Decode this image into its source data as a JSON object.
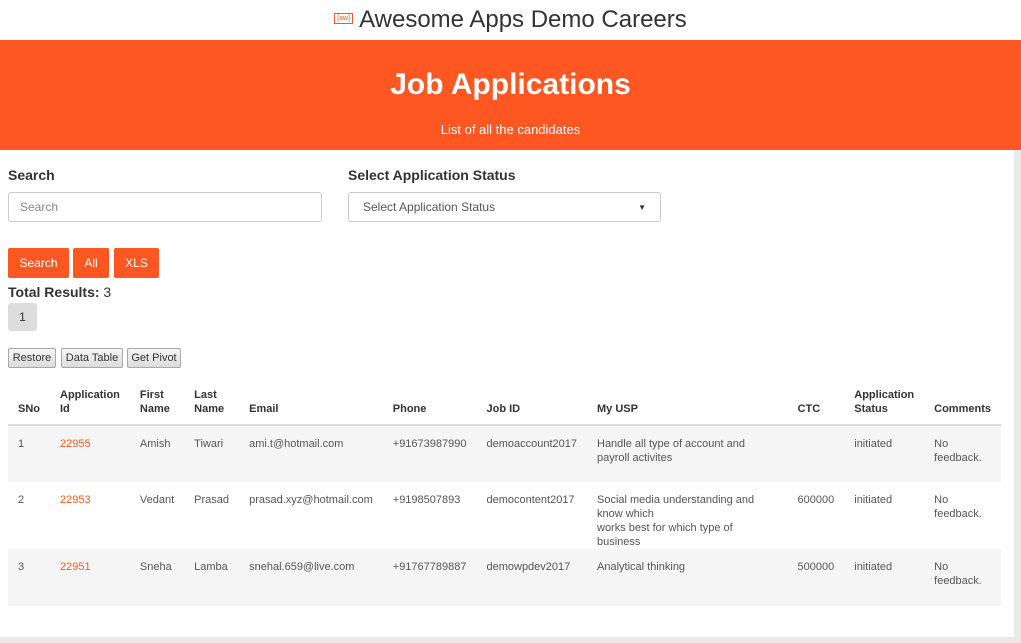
{
  "header": {
    "logo_text": "[aw]",
    "site_title": "Awesome Apps Demo Careers"
  },
  "banner": {
    "title": "Job Applications",
    "subtitle": "List of all the candidates"
  },
  "search": {
    "label": "Search",
    "placeholder": "Search",
    "value": ""
  },
  "status_filter": {
    "label": "Select Application Status",
    "selected": "Select Application Status"
  },
  "actions": {
    "search_label": "Search",
    "all_label": "All",
    "xls_label": "XLS"
  },
  "results": {
    "total_label": "Total Results:",
    "total_count": "3",
    "pages": [
      "1"
    ]
  },
  "toolbar": {
    "restore_label": "Restore",
    "data_table_label": "Data Table",
    "get_pivot_label": "Get Pivot"
  },
  "table": {
    "columns": [
      {
        "line1": "SNo",
        "line2": ""
      },
      {
        "line1": "Application",
        "line2": "Id"
      },
      {
        "line1": "First",
        "line2": "Name"
      },
      {
        "line1": "Last",
        "line2": "Name"
      },
      {
        "line1": "Email",
        "line2": ""
      },
      {
        "line1": "Phone",
        "line2": ""
      },
      {
        "line1": "Job ID",
        "line2": ""
      },
      {
        "line1": "My USP",
        "line2": ""
      },
      {
        "line1": "CTC",
        "line2": ""
      },
      {
        "line1": "Application",
        "line2": "Status"
      },
      {
        "line1": "Comments",
        "line2": ""
      }
    ],
    "rows": [
      {
        "sno": "1",
        "app_id": "22955",
        "first_name": "Amish",
        "last_name": "Tiwari",
        "email": "ami.t@hotmail.com",
        "phone": "+91673987990",
        "job_id": "demoaccount2017",
        "usp_line1": "Handle all type of account and payroll activites",
        "usp_line2": "",
        "ctc": "",
        "status": "initiated",
        "comments_line1": "No",
        "comments_line2": "feedback."
      },
      {
        "sno": "2",
        "app_id": "22953",
        "first_name": "Vedant",
        "last_name": "Prasad",
        "email": "prasad.xyz@hotmail.com",
        "phone": "+9198507893",
        "job_id": "democontent2017",
        "usp_line1": "Social media understanding and know which",
        "usp_line2": "works best for which type of business",
        "ctc": "600000",
        "status": "initiated",
        "comments_line1": "No",
        "comments_line2": "feedback."
      },
      {
        "sno": "3",
        "app_id": "22951",
        "first_name": "Sneha",
        "last_name": "Lamba",
        "email": "snehal.659@live.com",
        "phone": "+91767789887",
        "job_id": "demowpdev2017",
        "usp_line1": "Analytical thinking",
        "usp_line2": "",
        "ctc": "500000",
        "status": "initiated",
        "comments_line1": "No",
        "comments_line2": "feedback."
      }
    ]
  },
  "colors": {
    "accent": "#ff5722",
    "row_alt": "#f5f5f5",
    "border": "#dddddd"
  }
}
